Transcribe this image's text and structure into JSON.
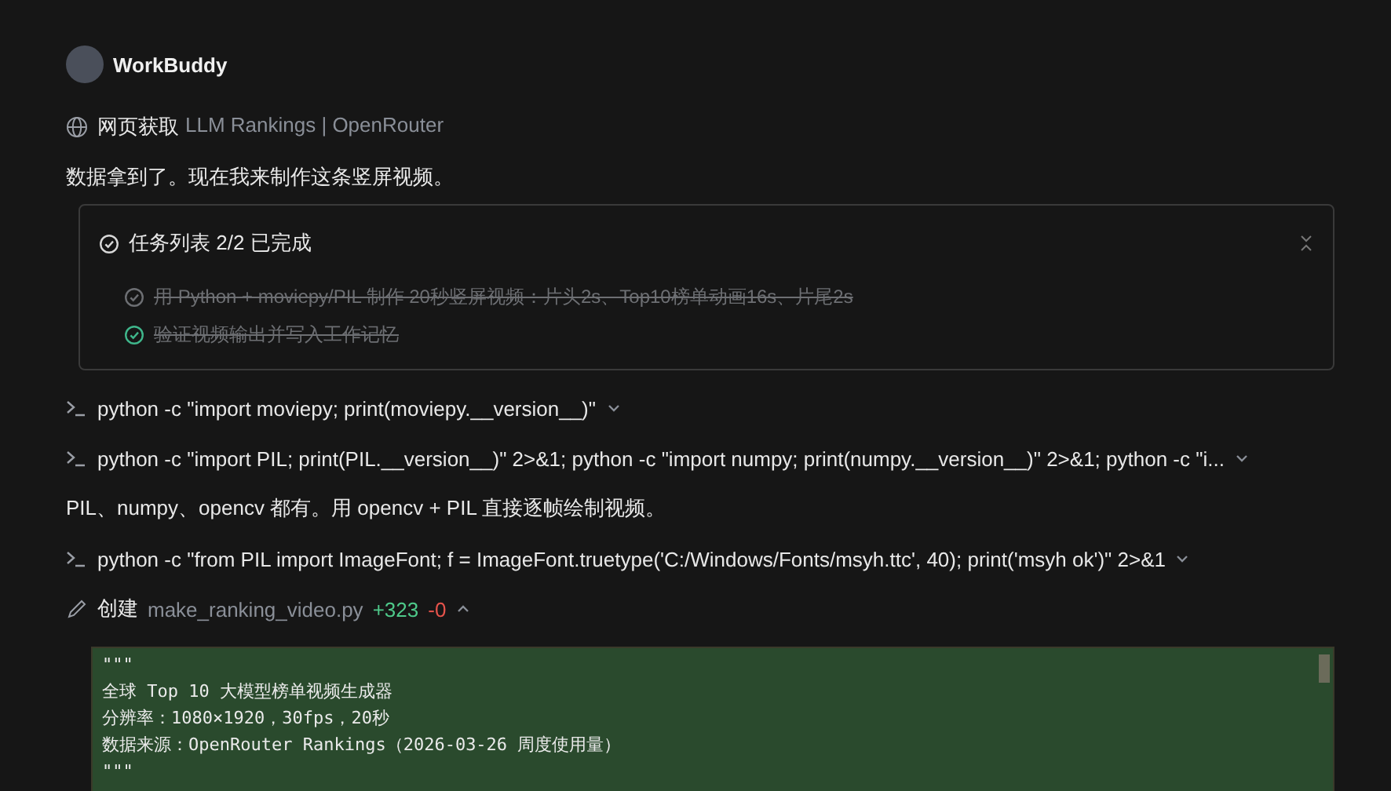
{
  "agent": {
    "name": "WorkBuddy"
  },
  "fetch": {
    "label": "网页获取",
    "title": "LLM Rankings | OpenRouter"
  },
  "message_1": "数据拿到了。现在我来制作这条竖屏视频。",
  "task_list": {
    "title": "任务列表 2/2 已完成",
    "expanded": true,
    "tasks": [
      {
        "text": "用 Python + moviepy/PIL 制作 20秒竖屏视频：片头2s、Top10榜单动画16s、片尾2s",
        "done": true,
        "latest": false
      },
      {
        "text": "验证视频输出并写入工作记忆",
        "done": true,
        "latest": true
      }
    ]
  },
  "commands_1": [
    {
      "text": "python -c \"import moviepy; print(moviepy.__version__)\"",
      "expanded": false
    },
    {
      "text": "python -c \"import PIL; print(PIL.__version__)\" 2>&1; python -c \"import numpy; print(numpy.__version__)\" 2>&1; python -c \"i...",
      "expanded": false
    }
  ],
  "message_2": "PIL、numpy、opencv 都有。用 opencv + PIL 直接逐帧绘制视频。",
  "commands_2": [
    {
      "text": "python -c \"from PIL import ImageFont; f = ImageFont.truetype('C:/Windows/Fonts/msyh.ttc', 40); print('msyh ok')\" 2>&1",
      "expanded": false
    }
  ],
  "file_change": {
    "action": "创建",
    "filename": "make_ranking_video.py",
    "added": "+323",
    "removed": "-0",
    "expanded": true,
    "code_lines": [
      "\"\"\"",
      "全球 Top 10 大模型榜单视频生成器",
      "分辨率：1080×1920，30fps，20秒",
      "数据来源：OpenRouter Rankings（2026-03-26 周度使用量）",
      "\"\"\""
    ]
  }
}
